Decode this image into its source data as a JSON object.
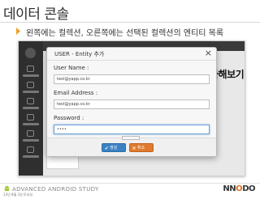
{
  "slide": {
    "title": "데이터 콘솔",
    "bullet": "왼쪽에는 컬렉션, 오른쪽에는 선택된 컬렉션의 엔티티 목록"
  },
  "background_app": {
    "add_button": "+ Add Collection",
    "list_items": [
      "user",
      "role",
      "group",
      "file",
      "device",
      "activity",
      "event"
    ],
    "side_text": "가해보기"
  },
  "modal": {
    "title": "USER - Entity 추가",
    "close_glyph": "×",
    "fields": {
      "username": {
        "label": "User Name :",
        "value": "test@yapp.co.kr"
      },
      "email": {
        "label": "Email Address :",
        "value": "test@yapp.co.kr"
      },
      "password": {
        "label": "Password :",
        "value": "••••"
      }
    },
    "buttons": {
      "save": "생성",
      "cancel": "취소"
    }
  },
  "footer": {
    "brand": "ADVANCED ANDROID STUDY",
    "date": "13년 8월 3일 토요일",
    "corner_logo_pre": "NN",
    "corner_logo_o": "O",
    "corner_logo_post": "DO"
  },
  "colors": {
    "save_button": "#3b82c4",
    "cancel_button": "#e07b2e",
    "bullet_accent": "#f0a020",
    "sidebar": "#2f2f2f"
  },
  "icons": {
    "bullet": "triangle-bullet-icon",
    "close": "close-icon",
    "save": "check-icon",
    "cancel": "close-icon",
    "footer_logo": "android-logo-icon"
  }
}
